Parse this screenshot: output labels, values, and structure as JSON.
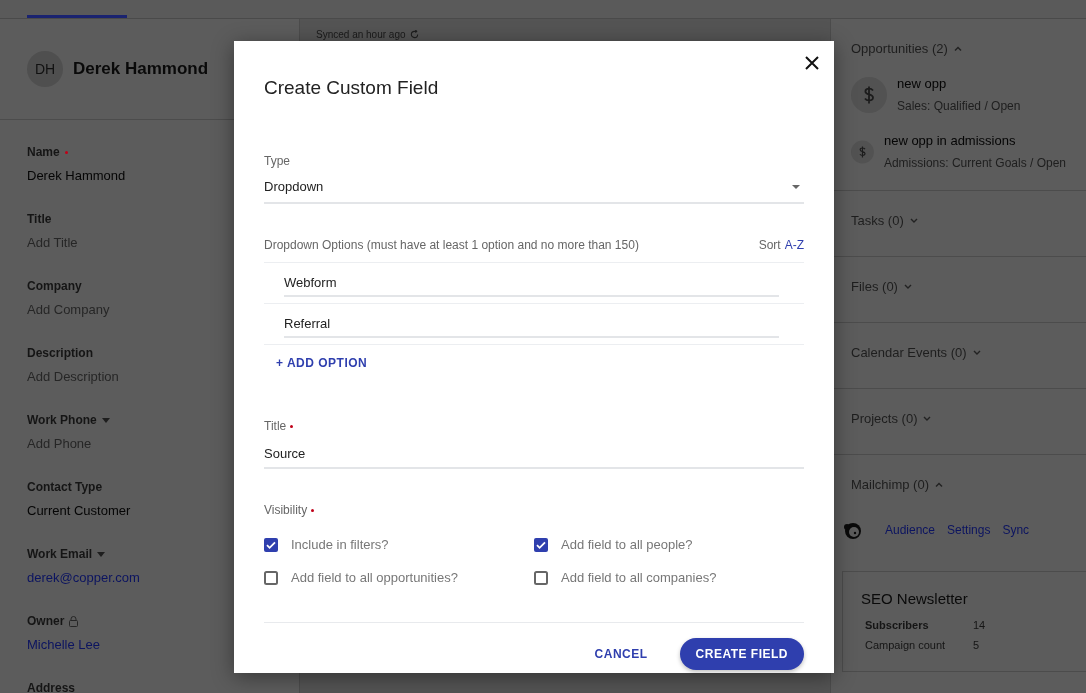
{
  "contact": {
    "initials": "DH",
    "name": "Derek Hammond",
    "fields": [
      {
        "label": "Name",
        "required": true,
        "has_dropdown": false,
        "locked": false,
        "kind": "text",
        "value": "Derek Hammond"
      },
      {
        "label": "Title",
        "required": false,
        "has_dropdown": false,
        "locked": false,
        "kind": "empty",
        "placeholder": "Add Title"
      },
      {
        "label": "Company",
        "required": false,
        "has_dropdown": false,
        "locked": false,
        "kind": "empty",
        "placeholder": "Add Company"
      },
      {
        "label": "Description",
        "required": false,
        "has_dropdown": false,
        "locked": false,
        "kind": "empty",
        "placeholder": "Add Description"
      },
      {
        "label": "Work Phone",
        "required": false,
        "has_dropdown": true,
        "locked": false,
        "kind": "empty",
        "placeholder": "Add Phone"
      },
      {
        "label": "Contact Type",
        "required": false,
        "has_dropdown": false,
        "locked": false,
        "kind": "text",
        "value": "Current Customer"
      },
      {
        "label": "Work Email",
        "required": false,
        "has_dropdown": true,
        "locked": false,
        "kind": "link",
        "value": "derek@copper.com"
      },
      {
        "label": "Owner",
        "required": false,
        "has_dropdown": false,
        "locked": true,
        "kind": "link",
        "value": "Michelle Lee"
      },
      {
        "label": "Address",
        "required": false,
        "has_dropdown": false,
        "locked": false,
        "kind": "none"
      }
    ]
  },
  "activity": {
    "sync_status": "Synced an hour ago"
  },
  "related": {
    "opportunities": {
      "title": "Opportunities (2)",
      "expanded": true,
      "items": [
        {
          "name": "new opp",
          "stage": "Sales: Qualified / Open"
        },
        {
          "name": "new opp in admissions",
          "stage": "Admissions: Current Goals / Open"
        }
      ]
    },
    "sections": [
      {
        "title": "Tasks (0)",
        "expanded": false
      },
      {
        "title": "Files (0)",
        "expanded": false
      },
      {
        "title": "Calendar Events (0)",
        "expanded": false
      },
      {
        "title": "Projects (0)",
        "expanded": false
      }
    ],
    "mailchimp": {
      "title": "Mailchimp (0)",
      "expanded": true,
      "links": [
        "Audience",
        "Settings",
        "Sync"
      ],
      "card": {
        "title": "SEO Newsletter",
        "rows": [
          {
            "label": "Subscribers",
            "value": "14",
            "emphasis": true
          },
          {
            "label": "Campaign count",
            "value": "5",
            "emphasis": false
          }
        ]
      }
    }
  },
  "dialog": {
    "title": "Create Custom Field",
    "type": {
      "label": "Type",
      "value": "Dropdown"
    },
    "options": {
      "label": "Dropdown Options (must have at least 1 option and no more than 150)",
      "sort_label": "Sort",
      "sort_link": "A-Z",
      "items": [
        "Webform",
        "Referral"
      ],
      "add_label": "+ ADD OPTION"
    },
    "title_field": {
      "label": "Title",
      "required": true,
      "value": "Source"
    },
    "visibility": {
      "label": "Visibility",
      "required": true,
      "checkboxes": [
        {
          "label": "Include in filters?",
          "checked": true
        },
        {
          "label": "Add field to all people?",
          "checked": true
        },
        {
          "label": "Add field to all opportunities?",
          "checked": false
        },
        {
          "label": "Add field to all companies?",
          "checked": false
        }
      ]
    },
    "buttons": {
      "cancel": "CANCEL",
      "create": "CREATE FIELD"
    }
  }
}
